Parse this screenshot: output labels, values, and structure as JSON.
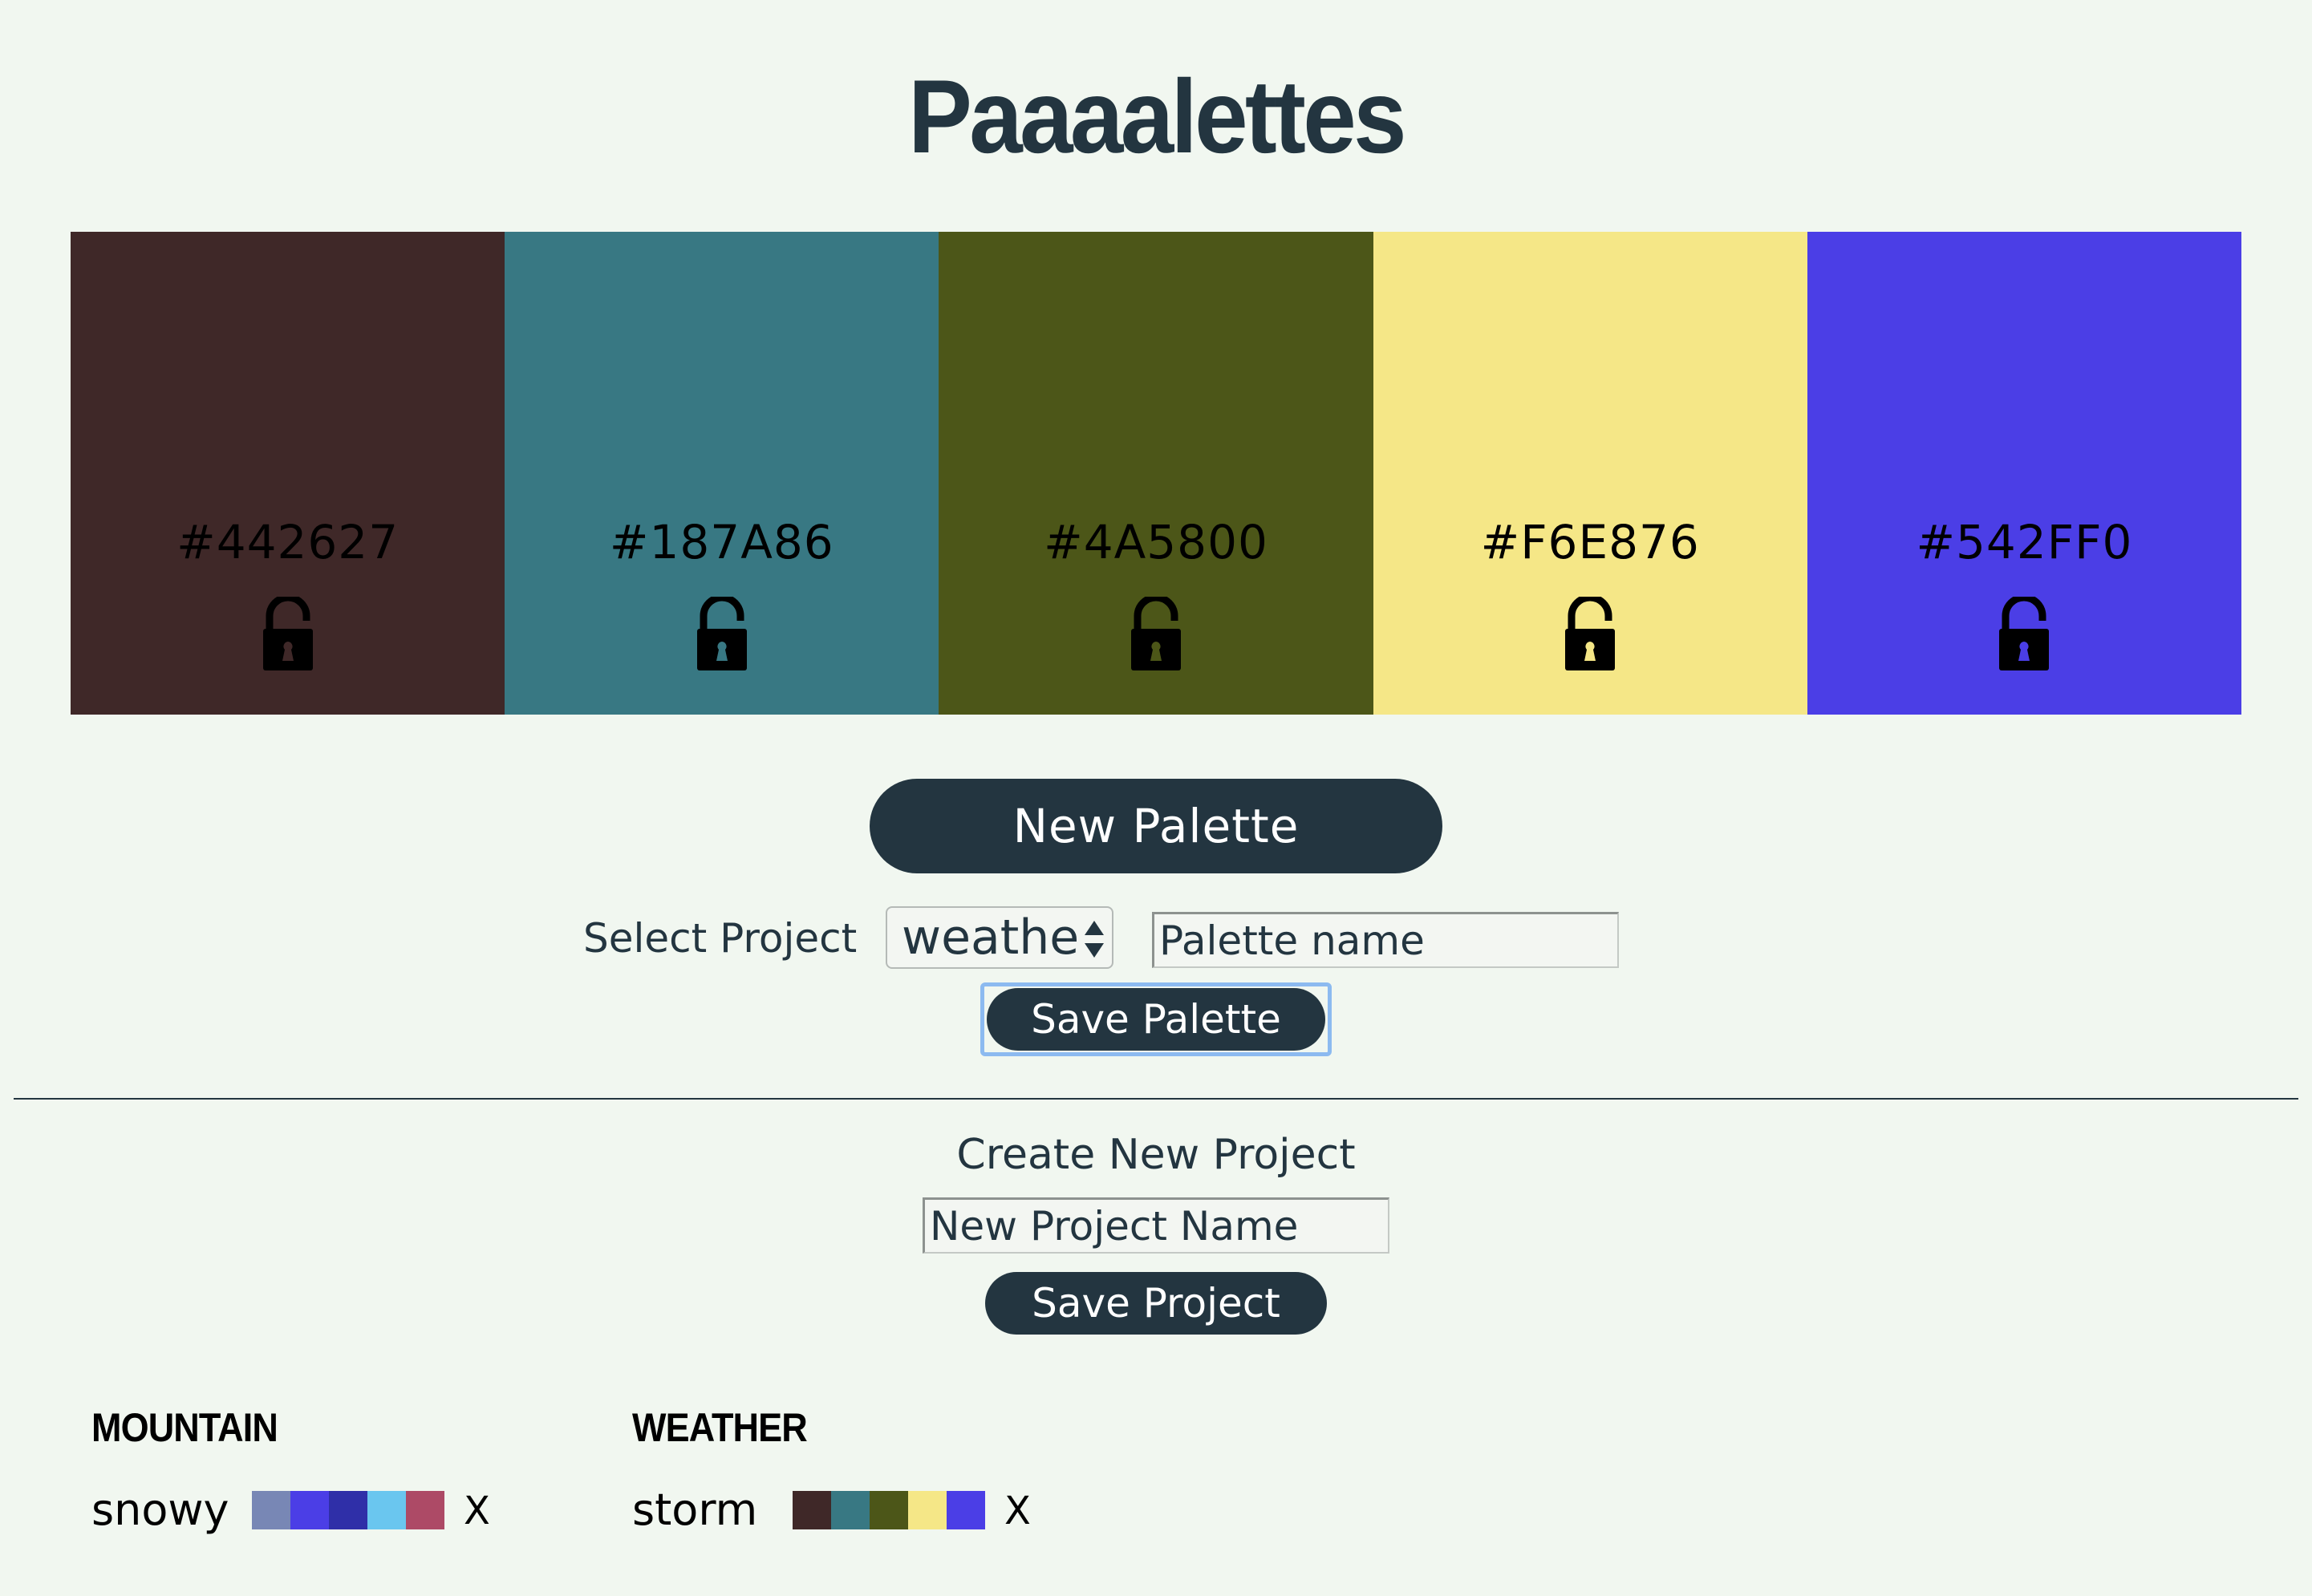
{
  "title": "Paaaalettes",
  "palette": [
    {
      "hex": "#442627",
      "color": "#3f2828",
      "lock_fill": "#3f2828"
    },
    {
      "hex": "#187A86",
      "color": "#387883",
      "lock_fill": "#387883"
    },
    {
      "hex": "#4A5800",
      "color": "#4c5618",
      "lock_fill": "#4c5618"
    },
    {
      "hex": "#F6E876",
      "color": "#f5e787",
      "lock_fill": "#f5e787"
    },
    {
      "hex": "#542FF0",
      "color": "#4b3ee6",
      "lock_fill": "#4b3ee6"
    }
  ],
  "lock_icon": "unlocked-padlock-icon",
  "new_palette_label": "New Palette",
  "select_project": {
    "label": "Select Project",
    "value": "weather",
    "icon": "select-arrows-icon"
  },
  "palette_name": {
    "placeholder": "Palette name"
  },
  "save_palette_label": "Save Palette",
  "create_project": {
    "label": "Create New Project",
    "placeholder": "New Project Name",
    "save_label": "Save Project"
  },
  "projects": [
    {
      "name": "MOUNTAIN",
      "palettes": [
        {
          "name": "snowy",
          "colors": [
            "#7887b5",
            "#4b3ee6",
            "#2f2fa8",
            "#6ac6ef",
            "#ad4a66"
          ],
          "delete": "X"
        }
      ]
    },
    {
      "name": "WEATHER",
      "palettes": [
        {
          "name": "storm",
          "colors": [
            "#3f2828",
            "#387883",
            "#4c5618",
            "#f5e787",
            "#4b3ee6"
          ],
          "delete": "X"
        }
      ]
    }
  ],
  "colors": {
    "background": "#f1f7f0",
    "primary": "#233540",
    "focus": "#8cbaf0"
  }
}
